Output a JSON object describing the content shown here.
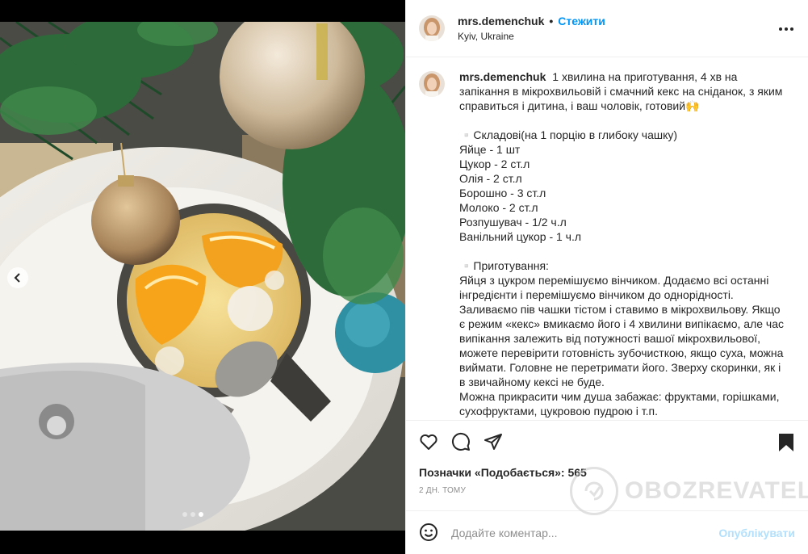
{
  "post": {
    "username": "mrs.demenchuk",
    "separator": "•",
    "follow_label": "Стежити",
    "location": "Kyiv, Ukraine"
  },
  "caption": {
    "username": "mrs.demenchuk",
    "intro": "1 хвилина на приготування, 4 хв на запікання в мікрохвильовій і смачний кекс на сніданок, з яким справиться і дитина, і ваш чоловік, готовий🙌",
    "ingredients_title": "▫️Складові(на 1 порцію в глибоку чашку)",
    "ingredients": [
      "Яйце - 1 шт",
      "Цукор - 2 ст.л",
      "Олія - 2 ст.л",
      "Борошно - 3 ст.л",
      "Молоко - 2 ст.л",
      "Розпушувач - 1/2 ч.л",
      "Ванільний цукор - 1 ч.л"
    ],
    "method_title": "▫️Приготування:",
    "method": [
      "Яйця з цукром перемішуємо вінчиком. Додаємо всі останні інгредієнти і перемішуємо вінчиком до однорідності.",
      "Заливаємо пів чашки тістом і ставимо в мікрохвильову. Якщо є режим «кекс» вмикаємо його і 4 хвилини випікаємо, але час випікання залежить від потужності вашої мікрохвильової, можете перевірити готовність зубочисткою, якщо суха, можна виймати. Головне не перетримати його. Зверху скоринки, як і в звичайному кексі не буде.",
      "Можна прикрасити чим душа забажає: фруктами, горішками, сухофруктами, цукровою пудрою і т.п."
    ]
  },
  "icons": {
    "like": "heart-icon",
    "comment": "comment-icon",
    "share": "share-icon",
    "save": "bookmark-icon",
    "emoji": "emoji-icon",
    "more": "more-icon",
    "prev": "chevron-left-icon"
  },
  "likes_text": "Позначки «Подобається»: 565",
  "time_text": "2 ДН. ТОМУ",
  "comment_box": {
    "placeholder": "Додайте коментар...",
    "publish_label": "Опублікувати"
  },
  "carousel": {
    "total": 3,
    "current": 3
  },
  "watermark": "OBOZREVATEL",
  "colors": {
    "accent": "#0095f6",
    "publish_disabled": "#b2dffc",
    "text": "#262626",
    "muted": "#8e8e8e"
  }
}
